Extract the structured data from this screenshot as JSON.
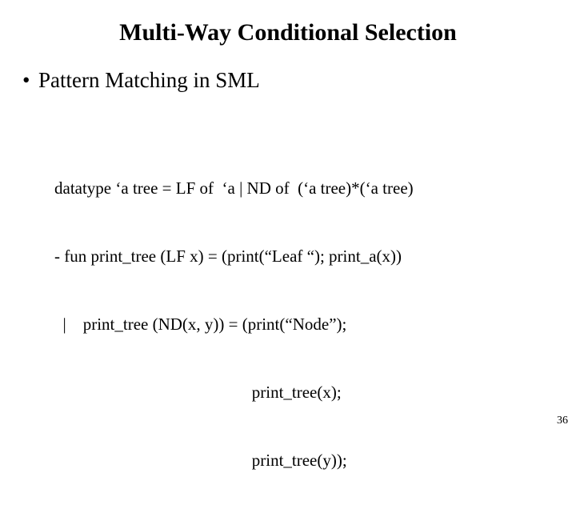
{
  "title": "Multi-Way Conditional Selection",
  "bullet1": "Pattern Matching in SML",
  "code": {
    "l1": "datatype ‘a tree = LF of  ‘a | ND of  (‘a tree)*(‘a tree)",
    "l2": "- fun print_tree (LF x) = (print(“Leaf “); print_a(x))",
    "l3": "  |    print_tree (ND(x, y)) = (print(“Node”);",
    "l4": "                                               print_tree(x);",
    "l5": "                                               print_tree(y));"
  },
  "pageNumber": "36"
}
